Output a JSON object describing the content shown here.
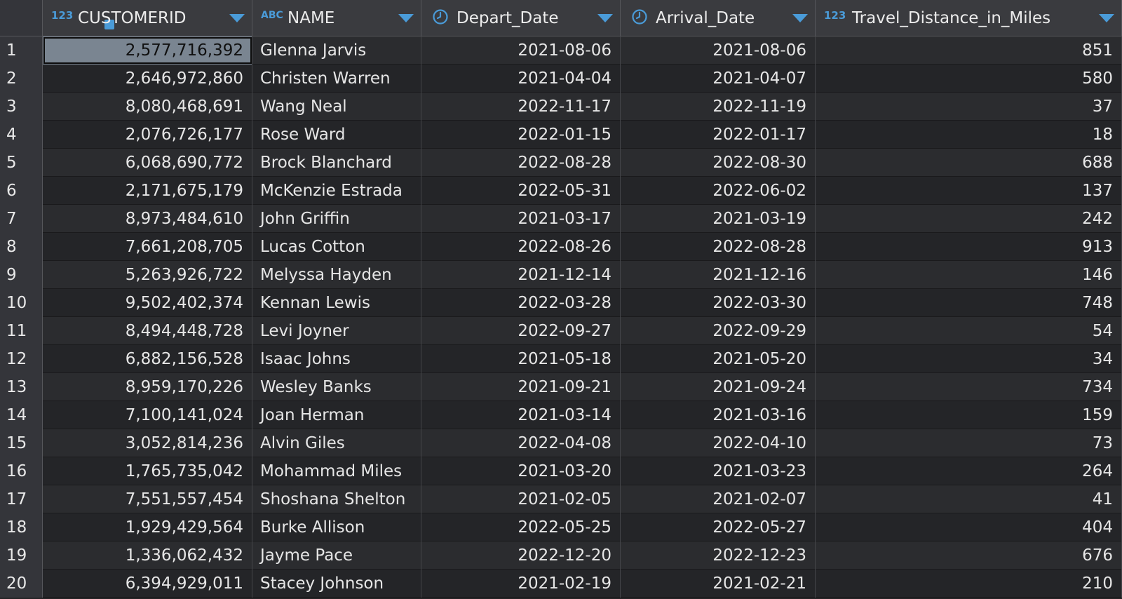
{
  "colors": {
    "accent": "#4a9bd8",
    "header_bg": "#3a3b3f",
    "selected_cell": "#7a8591"
  },
  "columns": [
    {
      "label": "CUSTOMERID",
      "type_icon": "123",
      "icon": "key-number-icon"
    },
    {
      "label": "NAME",
      "type_icon": "ABC",
      "icon": "text-type-icon"
    },
    {
      "label": "Depart_Date",
      "type_icon": "",
      "icon": "clock-icon"
    },
    {
      "label": "Arrival_Date",
      "type_icon": "",
      "icon": "clock-icon"
    },
    {
      "label": "Travel_Distance_in_Miles",
      "type_icon": "123",
      "icon": "number-type-icon"
    }
  ],
  "rows": [
    {
      "n": "1",
      "id": "2,577,716,392",
      "name": "Glenna Jarvis",
      "depart": "2021-08-06",
      "arrival": "2021-08-06",
      "miles": "851"
    },
    {
      "n": "2",
      "id": "2,646,972,860",
      "name": "Christen Warren",
      "depart": "2021-04-04",
      "arrival": "2021-04-07",
      "miles": "580"
    },
    {
      "n": "3",
      "id": "8,080,468,691",
      "name": "Wang Neal",
      "depart": "2022-11-17",
      "arrival": "2022-11-19",
      "miles": "37"
    },
    {
      "n": "4",
      "id": "2,076,726,177",
      "name": "Rose Ward",
      "depart": "2022-01-15",
      "arrival": "2022-01-17",
      "miles": "18"
    },
    {
      "n": "5",
      "id": "6,068,690,772",
      "name": "Brock Blanchard",
      "depart": "2022-08-28",
      "arrival": "2022-08-30",
      "miles": "688"
    },
    {
      "n": "6",
      "id": "2,171,675,179",
      "name": "McKenzie Estrada",
      "depart": "2022-05-31",
      "arrival": "2022-06-02",
      "miles": "137"
    },
    {
      "n": "7",
      "id": "8,973,484,610",
      "name": "John Griffin",
      "depart": "2021-03-17",
      "arrival": "2021-03-19",
      "miles": "242"
    },
    {
      "n": "8",
      "id": "7,661,208,705",
      "name": "Lucas Cotton",
      "depart": "2022-08-26",
      "arrival": "2022-08-28",
      "miles": "913"
    },
    {
      "n": "9",
      "id": "5,263,926,722",
      "name": "Melyssa Hayden",
      "depart": "2021-12-14",
      "arrival": "2021-12-16",
      "miles": "146"
    },
    {
      "n": "10",
      "id": "9,502,402,374",
      "name": "Kennan Lewis",
      "depart": "2022-03-28",
      "arrival": "2022-03-30",
      "miles": "748"
    },
    {
      "n": "11",
      "id": "8,494,448,728",
      "name": "Levi Joyner",
      "depart": "2022-09-27",
      "arrival": "2022-09-29",
      "miles": "54"
    },
    {
      "n": "12",
      "id": "6,882,156,528",
      "name": "Isaac Johns",
      "depart": "2021-05-18",
      "arrival": "2021-05-20",
      "miles": "34"
    },
    {
      "n": "13",
      "id": "8,959,170,226",
      "name": "Wesley Banks",
      "depart": "2021-09-21",
      "arrival": "2021-09-24",
      "miles": "734"
    },
    {
      "n": "14",
      "id": "7,100,141,024",
      "name": "Joan Herman",
      "depart": "2021-03-14",
      "arrival": "2021-03-16",
      "miles": "159"
    },
    {
      "n": "15",
      "id": "3,052,814,236",
      "name": "Alvin Giles",
      "depart": "2022-04-08",
      "arrival": "2022-04-10",
      "miles": "73"
    },
    {
      "n": "16",
      "id": "1,765,735,042",
      "name": "Mohammad Miles",
      "depart": "2021-03-20",
      "arrival": "2021-03-23",
      "miles": "264"
    },
    {
      "n": "17",
      "id": "7,551,557,454",
      "name": "Shoshana Shelton",
      "depart": "2021-02-05",
      "arrival": "2021-02-07",
      "miles": "41"
    },
    {
      "n": "18",
      "id": "1,929,429,564",
      "name": "Burke Allison",
      "depart": "2022-05-25",
      "arrival": "2022-05-27",
      "miles": "404"
    },
    {
      "n": "19",
      "id": "1,336,062,432",
      "name": "Jayme Pace",
      "depart": "2022-12-20",
      "arrival": "2022-12-23",
      "miles": "676"
    },
    {
      "n": "20",
      "id": "6,394,929,011",
      "name": "Stacey Johnson",
      "depart": "2021-02-19",
      "arrival": "2021-02-21",
      "miles": "210"
    }
  ]
}
